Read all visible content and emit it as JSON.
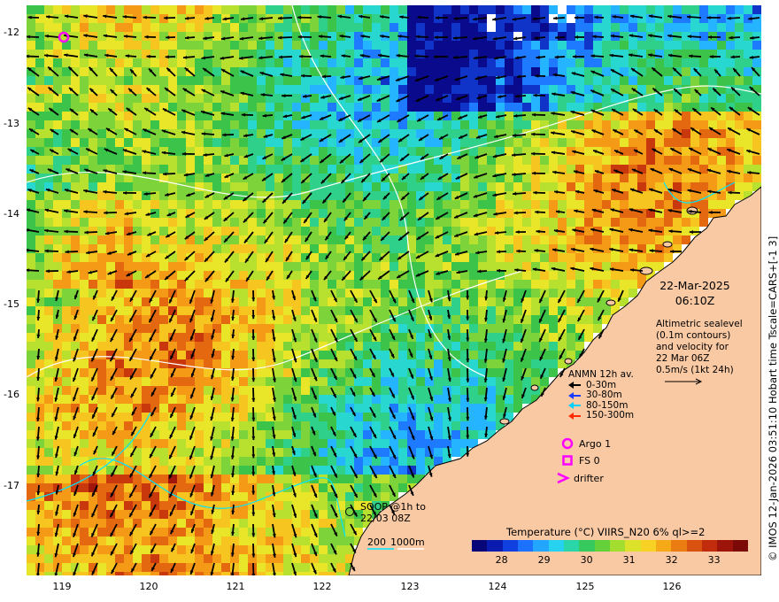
{
  "map": {
    "x_ticks": [
      "119",
      "120",
      "121",
      "122",
      "123",
      "124",
      "125",
      "126"
    ],
    "y_ticks": [
      "-12",
      "-13",
      "-14",
      "-15",
      "-16",
      "-17"
    ],
    "date": "22-Mar-2025",
    "time": "06:10Z",
    "altimetry_text": [
      "Altimetric sealevel",
      "(0.1m contours)",
      "and velocity for",
      "22 Mar 06Z",
      "0.5m/s (1kt 24h)"
    ],
    "anmn_title": "ANMN 12h av.",
    "anmn_legend": [
      {
        "label": "0-30m",
        "color": "#000000"
      },
      {
        "label": "30-80m",
        "color": "#1a3cff"
      },
      {
        "label": "80-150m",
        "color": "#00d0ff"
      },
      {
        "label": "150-300m",
        "color": "#ff2a00"
      }
    ],
    "argo_label": "Argo 1",
    "fs_label": "FS 0",
    "drifter_label": "drifter",
    "soop_label": [
      "SOOP @1h to",
      "22/03 08Z"
    ],
    "depth_labels": [
      "200",
      "1000m"
    ],
    "colorbar_title": "Temperature (°C) VIIRS_N20 6% ql>=2",
    "colorbar_ticks": [
      "28",
      "29",
      "30",
      "31",
      "32",
      "33"
    ],
    "colorbar_range": [
      27.3,
      33.8
    ],
    "credit": "© IMOS 12-Jan-2026 03:51:10 Hobart time Tscale=CARS+[-1 3]",
    "colors": {
      "land": "#f9c9a4",
      "argo": "#ff00ff",
      "fs": "#ff00ff",
      "drifter": "#ff00ff",
      "contour": "#ffffff",
      "contour_alt": "#00e5ff"
    }
  }
}
